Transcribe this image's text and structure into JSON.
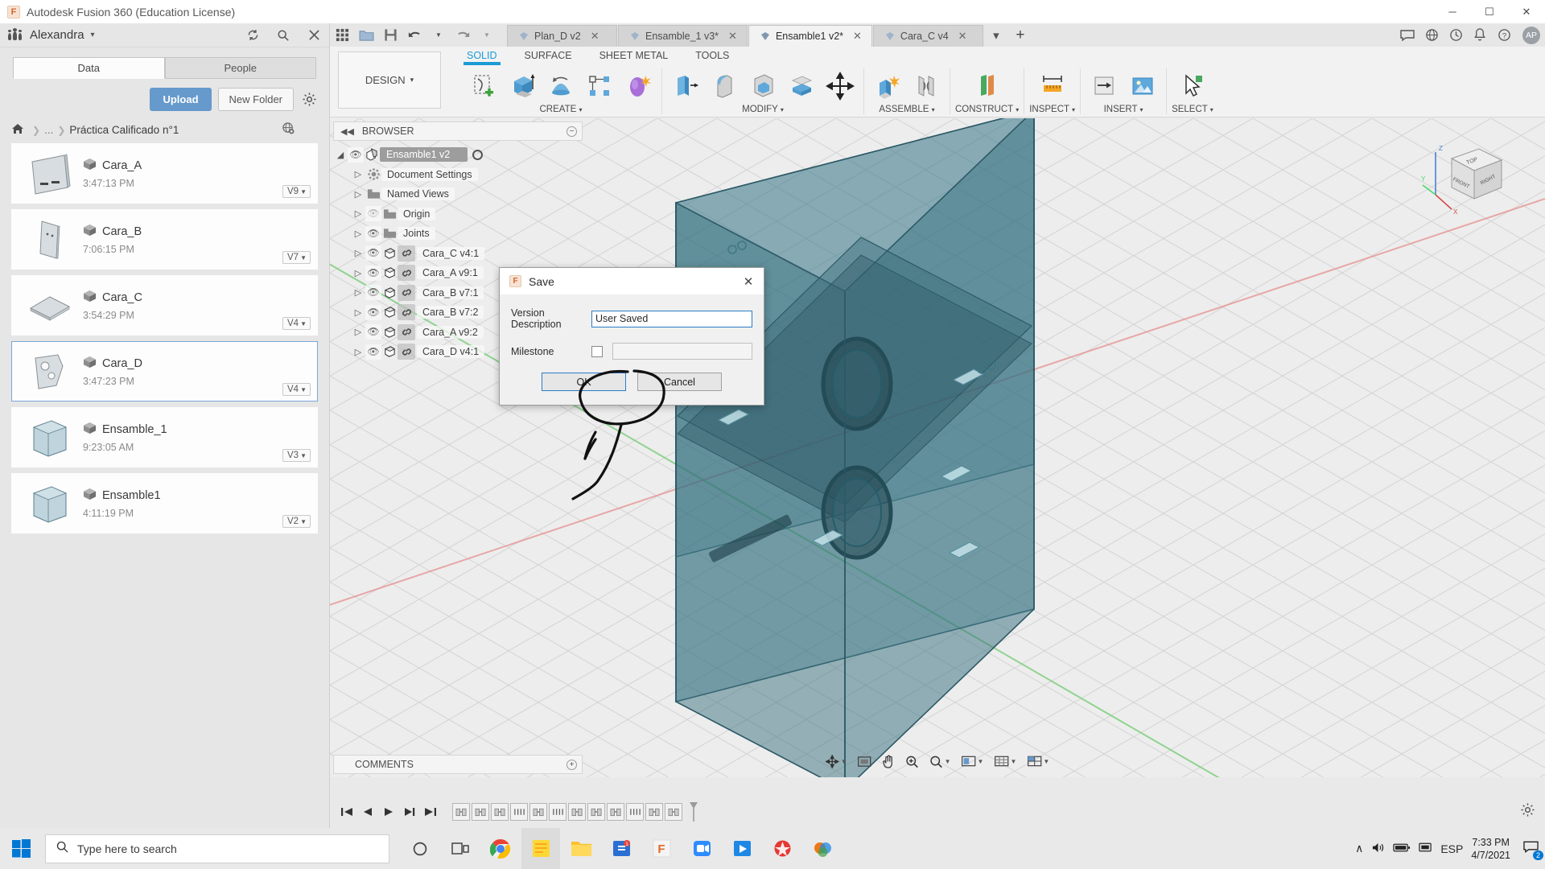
{
  "window": {
    "title": "Autodesk Fusion 360 (Education License)",
    "minimize": "─",
    "maximize": "☐",
    "close": "✕"
  },
  "left_panel": {
    "user": "Alexandra",
    "user_caret": "▾",
    "header_icons": [
      "refresh-icon",
      "search-icon",
      "close-icon"
    ],
    "tabs": [
      {
        "label": "Data",
        "active": true
      },
      {
        "label": "People",
        "active": false
      }
    ],
    "upload_label": "Upload",
    "new_folder_label": "New Folder",
    "breadcrumb": {
      "home": "⌂",
      "dots": "...",
      "current": "Práctica Calificado n°1"
    },
    "files": [
      {
        "name": "Cara_A",
        "time": "3:47:13 PM",
        "version": "V9",
        "selected": false
      },
      {
        "name": "Cara_B",
        "time": "7:06:15 PM",
        "version": "V7",
        "selected": false
      },
      {
        "name": "Cara_C",
        "time": "3:54:29 PM",
        "version": "V4",
        "selected": false
      },
      {
        "name": "Cara_D",
        "time": "3:47:23 PM",
        "version": "V4",
        "selected": true
      },
      {
        "name": "Ensamble_1",
        "time": "9:23:05 AM",
        "version": "V3",
        "selected": false
      },
      {
        "name": "Ensamble1",
        "time": "4:11:19 PM",
        "version": "V2",
        "selected": false
      }
    ]
  },
  "app_tabs": [
    {
      "label": "Plan_D v2",
      "active": false,
      "closable": true
    },
    {
      "label": "Ensamble_1 v3*",
      "active": false,
      "closable": true
    },
    {
      "label": "Ensamble1 v2*",
      "active": true,
      "closable": true
    },
    {
      "label": "Cara_C v4",
      "active": false,
      "closable": true
    }
  ],
  "app_tab_extras": {
    "overflow": "▾",
    "add": "+"
  },
  "app_toolbar_right": {
    "icons": [
      "comment-icon",
      "globe-icon",
      "clock-icon",
      "bell-icon",
      "help-icon"
    ],
    "avatar": "AP"
  },
  "ribbon": {
    "design_label": "DESIGN",
    "design_caret": "▾",
    "tabs": [
      {
        "label": "SOLID",
        "active": true
      },
      {
        "label": "SURFACE",
        "active": false
      },
      {
        "label": "SHEET METAL",
        "active": false
      },
      {
        "label": "TOOLS",
        "active": false
      }
    ],
    "groups": [
      {
        "label": "CREATE",
        "caret": "▾",
        "icons": [
          "sketch-create-icon",
          "extrude-icon",
          "revolve-icon",
          "hole-pattern-icon",
          "form-icon"
        ]
      },
      {
        "label": "MODIFY",
        "caret": "▾",
        "icons": [
          "press-pull-icon",
          "fillet-icon",
          "shell-icon",
          "combine-icon",
          "move-copy-icon"
        ]
      },
      {
        "label": "ASSEMBLE",
        "caret": "▾",
        "icons": [
          "new-component-icon",
          "joint-icon"
        ]
      },
      {
        "label": "CONSTRUCT",
        "caret": "▾",
        "icons": [
          "offset-plane-icon"
        ]
      },
      {
        "label": "INSPECT",
        "caret": "▾",
        "icons": [
          "measure-icon"
        ]
      },
      {
        "label": "INSERT",
        "caret": "▾",
        "icons": [
          "insert-derive-icon",
          "insert-canvas-icon"
        ]
      },
      {
        "label": "SELECT",
        "caret": "▾",
        "icons": [
          "select-icon"
        ]
      }
    ]
  },
  "browser": {
    "title": "BROWSER",
    "collapse_icon": "◀◀",
    "minus_icon": "−",
    "items": [
      {
        "label": "Ensamble1 v2",
        "type": "root",
        "indent": 0,
        "eye": "on",
        "icon": "component-icon"
      },
      {
        "label": "Document Settings",
        "type": "folder",
        "indent": 1,
        "eye": "none",
        "icon": "gear-icon"
      },
      {
        "label": "Named Views",
        "type": "folder",
        "indent": 1,
        "eye": "none",
        "icon": "folder-icon"
      },
      {
        "label": "Origin",
        "type": "folder",
        "indent": 1,
        "eye": "off",
        "icon": "folder-icon"
      },
      {
        "label": "Joints",
        "type": "folder",
        "indent": 1,
        "eye": "on",
        "icon": "folder-icon"
      },
      {
        "label": "Cara_C v4:1",
        "type": "component",
        "indent": 1,
        "eye": "on",
        "icon": "body-icon"
      },
      {
        "label": "Cara_A v9:1",
        "type": "component",
        "indent": 1,
        "eye": "on",
        "icon": "body-icon"
      },
      {
        "label": "Cara_B v7:1",
        "type": "component",
        "indent": 1,
        "eye": "on",
        "icon": "body-icon"
      },
      {
        "label": "Cara_B v7:2",
        "type": "component",
        "indent": 1,
        "eye": "on",
        "icon": "body-icon"
      },
      {
        "label": "Cara_A v9:2",
        "type": "component",
        "indent": 1,
        "eye": "on",
        "icon": "body-icon"
      },
      {
        "label": "Cara_D v4:1",
        "type": "component",
        "indent": 1,
        "eye": "on",
        "icon": "body-icon"
      }
    ]
  },
  "comments": {
    "label": "COMMENTS",
    "plus": "+"
  },
  "viewcube": {
    "top": "TOP",
    "front": "FRONT",
    "right": "RIGHT",
    "axis_z": "Z",
    "axis_x": "X",
    "axis_y": "Y"
  },
  "navbar": {
    "items": [
      {
        "name": "orbit-icon",
        "glyph": "✣",
        "caret": "▾"
      },
      {
        "name": "pan-display-icon",
        "glyph": "▣",
        "caret": ""
      },
      {
        "name": "pan-hand-icon",
        "glyph": "✋",
        "caret": ""
      },
      {
        "name": "zoom-icon",
        "glyph": "⊕",
        "caret": ""
      },
      {
        "name": "zoom-window-icon",
        "glyph": "⌕",
        "caret": "▾"
      },
      {
        "name": "display-settings-icon",
        "glyph": "◑",
        "caret": "▾"
      },
      {
        "name": "grid-snap-icon",
        "glyph": "⊞",
        "caret": "▾"
      },
      {
        "name": "viewports-icon",
        "glyph": "▦",
        "caret": "▾"
      }
    ]
  },
  "timeline": {
    "controls": [
      "skip-start-icon",
      "step-back-icon",
      "play-icon",
      "step-forward-icon",
      "skip-end-icon"
    ],
    "control_glyphs": [
      "⏮",
      "◀",
      "▶",
      "▶▏",
      "⏭"
    ],
    "features": [
      "joint-feature",
      "joint-feature",
      "joint-feature",
      "joint-feature",
      "joint-feature",
      "joint-feature",
      "joint-feature",
      "joint-feature",
      "joint-feature",
      "joint-feature",
      "joint-feature",
      "joint-feature"
    ],
    "settings_icon": "⚙"
  },
  "dialog": {
    "title": "Save",
    "close": "✕",
    "version_description_label": "Version Description",
    "version_description_value": "User Saved",
    "milestone_label": "Milestone",
    "milestone_checked": false,
    "milestone_value": "",
    "ok_label": "OK",
    "cancel_label": "Cancel"
  },
  "taskbar": {
    "search_placeholder": "Type here to search",
    "search_icon": "⌕",
    "apps": [
      {
        "name": "cortana-icon",
        "glyph": "○"
      },
      {
        "name": "task-view-icon",
        "glyph": "⌸"
      },
      {
        "name": "chrome-icon",
        "glyph": ""
      },
      {
        "name": "sticky-notes-icon",
        "glyph": ""
      },
      {
        "name": "file-explorer-icon",
        "glyph": ""
      },
      {
        "name": "store-icon",
        "glyph": ""
      },
      {
        "name": "fusion360-icon",
        "glyph": ""
      },
      {
        "name": "zoom-app-icon",
        "glyph": ""
      },
      {
        "name": "movies-tv-icon",
        "glyph": ""
      },
      {
        "name": "video-editor-icon",
        "glyph": ""
      },
      {
        "name": "paint3d-icon",
        "glyph": ""
      }
    ],
    "tray": {
      "chevron": "∧",
      "volume": "◁)",
      "battery": "▭",
      "network": "□",
      "language": "ESP",
      "time": "7:33 PM",
      "date": "4/7/2021",
      "notification_count": "2"
    }
  },
  "colors": {
    "accent_blue": "#6699cc",
    "tab_active_blue": "#1a9bd7",
    "model_teal": "#2f6d80",
    "selection_border": "#7ba7d7"
  }
}
